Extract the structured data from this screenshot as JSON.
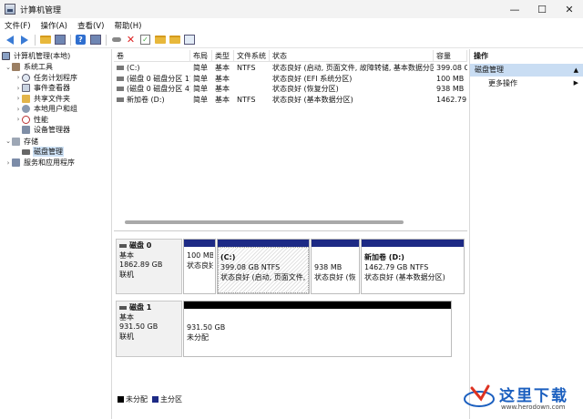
{
  "window": {
    "title": "计算机管理",
    "minimize_glyph": "—",
    "maximize_glyph": "☐",
    "close_glyph": "✕"
  },
  "menubar": [
    "文件(F)",
    "操作(A)",
    "查看(V)",
    "帮助(H)"
  ],
  "toolbar": {
    "icons": [
      "back-arrow-icon",
      "forward-arrow-icon",
      "up-folder-icon",
      "show-hide-tree-icon",
      "help-icon",
      "properties-icon",
      "connect-icon",
      "delete-icon",
      "check-icon",
      "folder-icon",
      "search-icon",
      "list-view-icon"
    ]
  },
  "tree": {
    "root": "计算机管理(本地)",
    "items": [
      {
        "label": "系统工具",
        "expander": "⌄"
      },
      {
        "label": "任务计划程序",
        "expander": "›"
      },
      {
        "label": "事件查看器",
        "expander": "›"
      },
      {
        "label": "共享文件夹",
        "expander": "›"
      },
      {
        "label": "本地用户和组",
        "expander": "›"
      },
      {
        "label": "性能",
        "expander": "›"
      },
      {
        "label": "设备管理器",
        "expander": ""
      },
      {
        "label": "存储",
        "expander": "⌄"
      },
      {
        "label": "磁盘管理",
        "expander": ""
      },
      {
        "label": "服务和应用程序",
        "expander": "›"
      }
    ]
  },
  "volume_list": {
    "columns": [
      "卷",
      "布局",
      "类型",
      "文件系统",
      "状态",
      "容量"
    ],
    "rows": [
      {
        "volume": "(C:)",
        "layout": "简单",
        "type": "基本",
        "fs": "NTFS",
        "status": "状态良好 (启动, 页面文件, 故障转储, 基本数据分区)",
        "capacity": "399.08 G"
      },
      {
        "volume": "(磁盘 0 磁盘分区 1)",
        "layout": "简单",
        "type": "基本",
        "fs": "",
        "status": "状态良好 (EFI 系统分区)",
        "capacity": "100 MB"
      },
      {
        "volume": "(磁盘 0 磁盘分区 4)",
        "layout": "简单",
        "type": "基本",
        "fs": "",
        "status": "状态良好 (恢复分区)",
        "capacity": "938 MB"
      },
      {
        "volume": "新加卷 (D:)",
        "layout": "简单",
        "type": "基本",
        "fs": "NTFS",
        "status": "状态良好 (基本数据分区)",
        "capacity": "1462.79"
      }
    ]
  },
  "disks": [
    {
      "name": "磁盘 0",
      "type": "基本",
      "size": "1862.89 GB",
      "state": "联机",
      "partitions": [
        {
          "name": "",
          "size": "100 MB",
          "status": "状态良好"
        },
        {
          "name": "(C:)",
          "size": "399.08 GB NTFS",
          "status": "状态良好 (启动, 页面文件, 故"
        },
        {
          "name": "",
          "size": "938 MB",
          "status": "状态良好 (恢"
        },
        {
          "name": "新加卷 (D:)",
          "size": "1462.79 GB NTFS",
          "status": "状态良好 (基本数据分区)"
        }
      ]
    },
    {
      "name": "磁盘 1",
      "type": "基本",
      "size": "931.50 GB",
      "state": "联机",
      "partitions": [
        {
          "size": "931.50 GB",
          "status": "未分配"
        }
      ]
    }
  ],
  "legend": [
    {
      "label": "未分配",
      "color": "#000000"
    },
    {
      "label": "主分区",
      "color": "#1d2a85"
    }
  ],
  "actions": {
    "header": "操作",
    "section": "磁盘管理",
    "section_caret": "▲",
    "items": [
      {
        "label": "更多操作",
        "caret": "▶"
      }
    ]
  },
  "watermark": {
    "text": "这里下载",
    "url": "www.herodown.com"
  }
}
